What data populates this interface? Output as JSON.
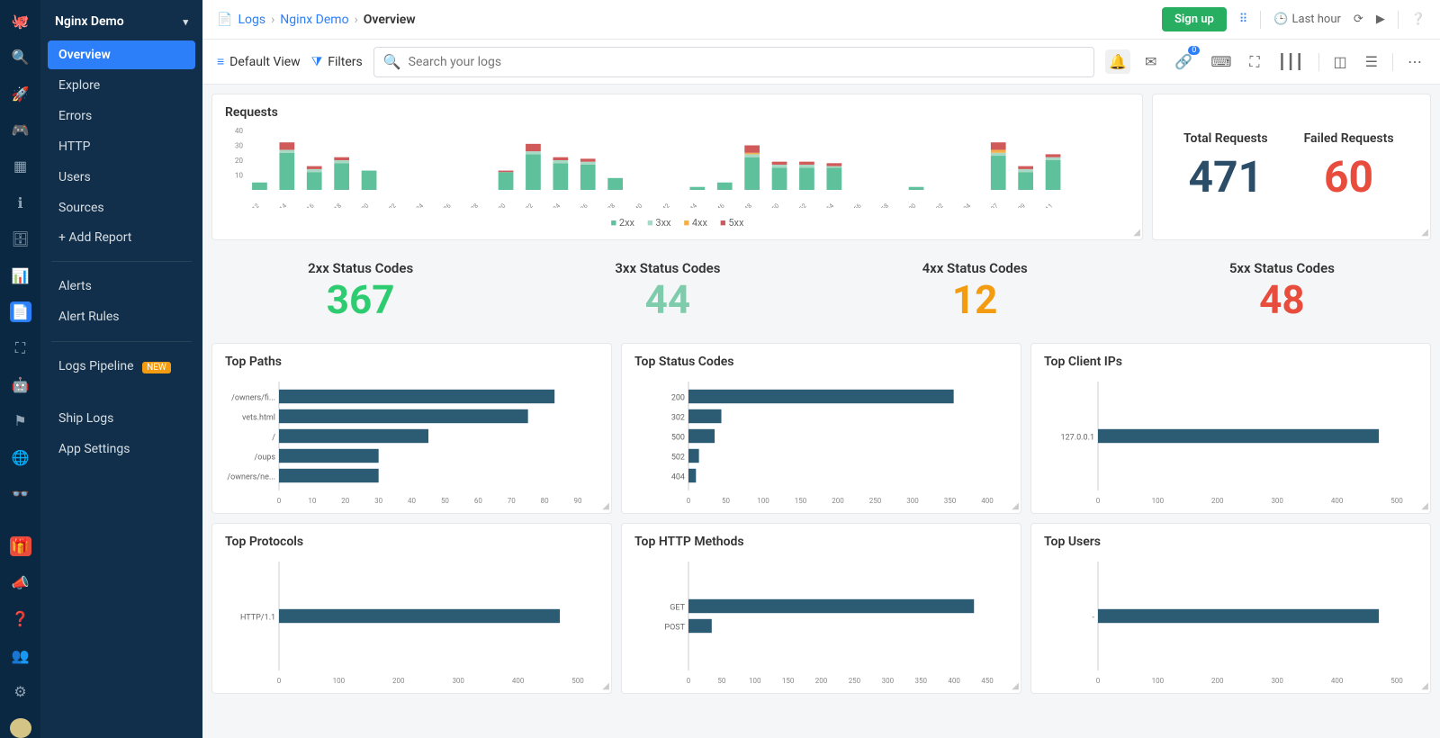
{
  "app_name": "Nginx Demo",
  "icon_rail": [
    "octopus-logo",
    "search",
    "rocket",
    "octopus",
    "grid",
    "info",
    "archive",
    "chart",
    "file",
    "focus",
    "robot",
    "flag",
    "globe",
    "stack"
  ],
  "icon_rail_bottom": [
    "gift",
    "megaphone",
    "help",
    "team",
    "gear",
    "avatar"
  ],
  "icon_rail_active_index": 8,
  "sidebar": {
    "items": [
      {
        "label": "Overview",
        "active": true
      },
      {
        "label": "Explore"
      },
      {
        "label": "Errors"
      },
      {
        "label": "HTTP"
      },
      {
        "label": "Users"
      },
      {
        "label": "Sources"
      }
    ],
    "add_report": "Add Report",
    "alerts": "Alerts",
    "alert_rules": "Alert Rules",
    "logs_pipeline": "Logs Pipeline",
    "logs_pipeline_badge": "NEW",
    "ship_logs": "Ship Logs",
    "app_settings": "App Settings"
  },
  "breadcrumbs": {
    "icon": "file",
    "logs": "Logs",
    "nginx": "Nginx Demo",
    "current": "Overview"
  },
  "topbar": {
    "signup": "Sign up",
    "time_range": "Last hour"
  },
  "toolbar": {
    "default_view": "Default View",
    "filters": "Filters",
    "search_placeholder": "Search your logs",
    "link_badge": "0"
  },
  "kpis": {
    "total_requests": {
      "label": "Total Requests",
      "value": "471"
    },
    "failed_requests": {
      "label": "Failed Requests",
      "value": "60"
    }
  },
  "status_codes": [
    {
      "label": "2xx Status Codes",
      "value": "367",
      "cls": "g1"
    },
    {
      "label": "3xx Status Codes",
      "value": "44",
      "cls": "g2"
    },
    {
      "label": "4xx Status Codes",
      "value": "12",
      "cls": "o"
    },
    {
      "label": "5xx Status Codes",
      "value": "48",
      "cls": "r"
    }
  ],
  "panels": {
    "requests": "Requests",
    "top_paths": "Top Paths",
    "top_status_codes": "Top Status Codes",
    "top_client_ips": "Top Client IPs",
    "top_protocols": "Top Protocols",
    "top_http_methods": "Top HTTP Methods",
    "top_users": "Top Users"
  },
  "chart_data": [
    {
      "id": "requests",
      "type": "bar",
      "stacked": true,
      "ylim": [
        0,
        40
      ],
      "yticks": [
        10,
        20,
        30,
        40
      ],
      "series": [
        "2xx",
        "3xx",
        "4xx",
        "5xx"
      ],
      "colors": {
        "2xx": "#5fc19b",
        "3xx": "#a8d9c5",
        "4xx": "#f3b04a",
        "5xx": "#d05a5a"
      },
      "categories": [
        "05:12",
        "05:14",
        "05:16",
        "05:18",
        "05:20",
        "05:22",
        "05:24",
        "05:26",
        "05:28",
        "05:30",
        "05:32",
        "05:34",
        "05:36",
        "05:38",
        "05:40",
        "05:42",
        "05:44",
        "05:46",
        "05:48",
        "05:50",
        "05:52",
        "05:54",
        "05:56",
        "05:58",
        "06:00",
        "06:02",
        "06:04",
        "06:07",
        "06:09",
        "06:11"
      ],
      "data": [
        {
          "x": "05:12",
          "2xx": 5,
          "5xx": 0
        },
        {
          "x": "05:14",
          "2xx": 25,
          "5xx": 5,
          "3xx": 2
        },
        {
          "x": "05:16",
          "2xx": 12,
          "5xx": 2,
          "3xx": 2
        },
        {
          "x": "05:18",
          "2xx": 18,
          "5xx": 2,
          "3xx": 2
        },
        {
          "x": "05:20",
          "2xx": 13,
          "5xx": 0
        },
        {
          "x": "05:30",
          "2xx": 12,
          "5xx": 1
        },
        {
          "x": "05:32",
          "2xx": 24,
          "3xx": 2,
          "5xx": 5
        },
        {
          "x": "05:34",
          "2xx": 18,
          "5xx": 2,
          "3xx": 2
        },
        {
          "x": "05:36",
          "2xx": 17,
          "3xx": 2,
          "5xx": 2
        },
        {
          "x": "05:38",
          "2xx": 8
        },
        {
          "x": "05:44",
          "2xx": 2
        },
        {
          "x": "05:46",
          "2xx": 5
        },
        {
          "x": "05:48",
          "2xx": 22,
          "3xx": 2,
          "5xx": 5,
          "4xx": 1
        },
        {
          "x": "05:50",
          "2xx": 15,
          "5xx": 2,
          "3xx": 2
        },
        {
          "x": "05:52",
          "2xx": 15,
          "5xx": 2,
          "3xx": 2
        },
        {
          "x": "05:54",
          "2xx": 15,
          "5xx": 2,
          "3xx": 1
        },
        {
          "x": "06:00",
          "2xx": 2
        },
        {
          "x": "06:07",
          "2xx": 23,
          "3xx": 2,
          "5xx": 5,
          "4xx": 2
        },
        {
          "x": "06:09",
          "2xx": 12,
          "5xx": 2,
          "3xx": 2
        },
        {
          "x": "06:11",
          "2xx": 20,
          "5xx": 2,
          "3xx": 2
        }
      ]
    },
    {
      "id": "top_paths",
      "type": "bar",
      "orientation": "horizontal",
      "categories": [
        "/owners/fi...",
        "vets.html",
        "/",
        "/oups",
        "/owners/ne..."
      ],
      "values": [
        83,
        75,
        45,
        30,
        30
      ],
      "xlim": [
        0,
        90
      ],
      "xticks": [
        0,
        10,
        20,
        30,
        40,
        50,
        60,
        70,
        80,
        90
      ],
      "color": "#2c5b74"
    },
    {
      "id": "top_status_codes",
      "type": "bar",
      "orientation": "horizontal",
      "categories": [
        "200",
        "302",
        "500",
        "502",
        "404"
      ],
      "values": [
        355,
        44,
        35,
        14,
        10
      ],
      "xlim": [
        0,
        400
      ],
      "xticks": [
        0,
        50,
        100,
        150,
        200,
        250,
        300,
        350,
        400
      ],
      "color": "#2c5b74"
    },
    {
      "id": "top_client_ips",
      "type": "bar",
      "orientation": "horizontal",
      "categories": [
        "127.0.0.1"
      ],
      "values": [
        470
      ],
      "xlim": [
        0,
        500
      ],
      "xticks": [
        0,
        100,
        200,
        300,
        400,
        500
      ],
      "color": "#2c5b74"
    },
    {
      "id": "top_protocols",
      "type": "bar",
      "orientation": "horizontal",
      "categories": [
        "HTTP/1.1"
      ],
      "values": [
        470
      ],
      "xlim": [
        0,
        500
      ],
      "xticks": [
        0,
        100,
        200,
        300,
        400,
        500
      ],
      "color": "#2c5b74"
    },
    {
      "id": "top_http_methods",
      "type": "bar",
      "orientation": "horizontal",
      "categories": [
        "GET",
        "POST"
      ],
      "values": [
        430,
        35
      ],
      "xlim": [
        0,
        450
      ],
      "xticks": [
        0,
        50,
        100,
        150,
        200,
        250,
        300,
        350,
        400,
        450
      ],
      "color": "#2c5b74"
    },
    {
      "id": "top_users",
      "type": "bar",
      "orientation": "horizontal",
      "categories": [
        "-"
      ],
      "values": [
        470
      ],
      "xlim": [
        0,
        500
      ],
      "xticks": [
        0,
        100,
        200,
        300,
        400,
        500
      ],
      "color": "#2c5b74"
    }
  ]
}
